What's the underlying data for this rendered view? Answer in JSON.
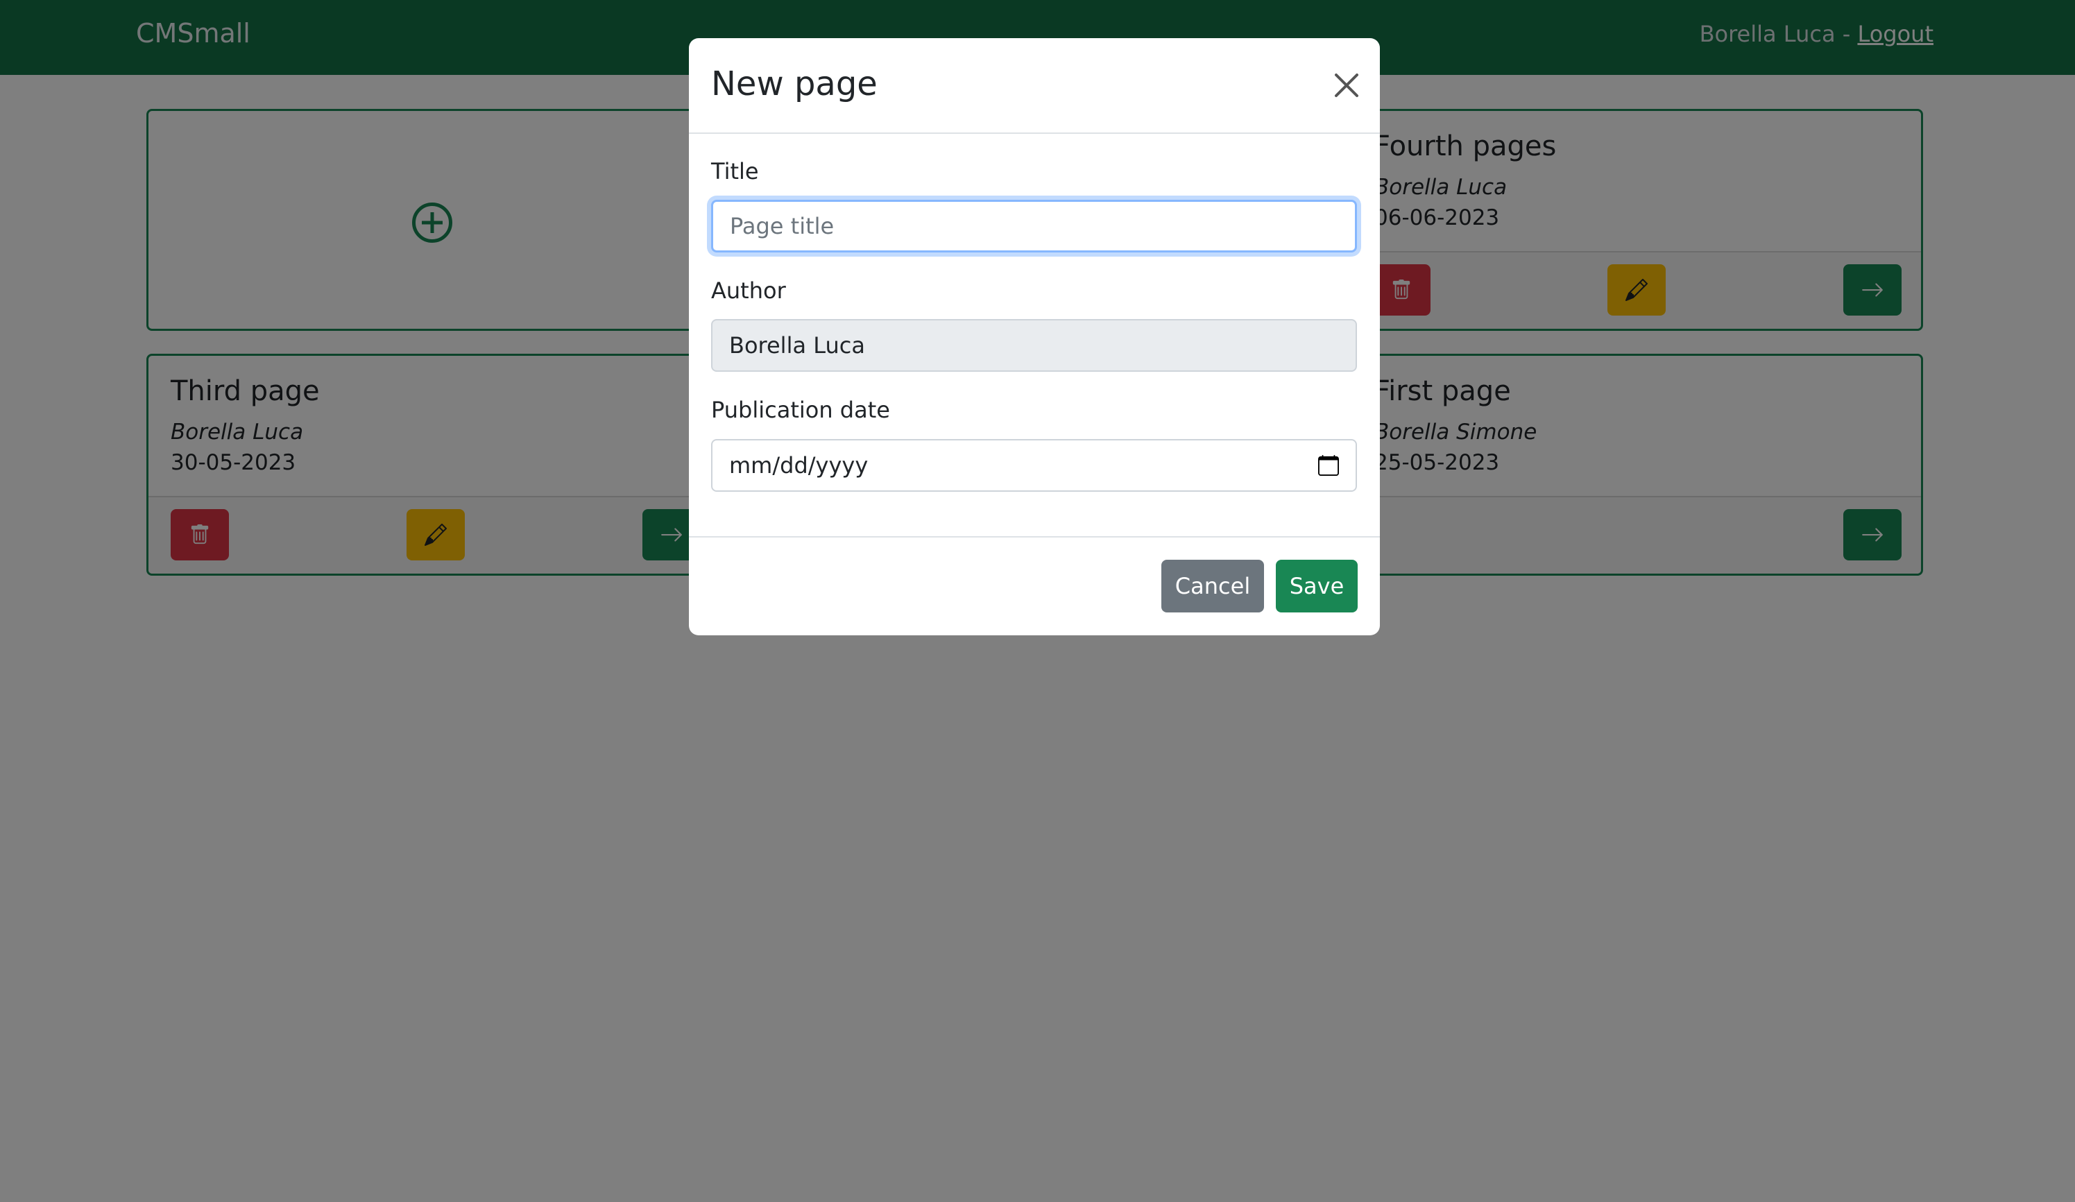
{
  "navbar": {
    "brand": "CMSmall",
    "user": "Borella Luca - ",
    "logout": "Logout"
  },
  "cards": [
    {
      "title": "Third page",
      "author": "Borella Luca",
      "date": "30-05-2023"
    },
    {
      "title": "Fourth pages",
      "author": "Borella Luca",
      "date": "06-06-2023"
    },
    {
      "title": "First page",
      "author": "Borella Simone",
      "date": "25-05-2023"
    }
  ],
  "modal": {
    "title": "New page",
    "title_label": "Title",
    "title_placeholder": "Page title",
    "title_value": "",
    "author_label": "Author",
    "author_value": "Borella Luca",
    "date_label": "Publication date",
    "date_placeholder": "mm/dd/yyyy",
    "cancel_label": "Cancel",
    "save_label": "Save"
  },
  "icons": {
    "add": "plus-circle-icon",
    "delete": "trash-icon",
    "edit": "pencil-icon",
    "open": "arrow-right-icon",
    "close": "close-icon",
    "calendar": "calendar-icon"
  },
  "colors": {
    "navbar": "#157347",
    "success": "#198754",
    "danger": "#dc3545",
    "warning": "#ffc107",
    "secondary": "#6c757d"
  }
}
